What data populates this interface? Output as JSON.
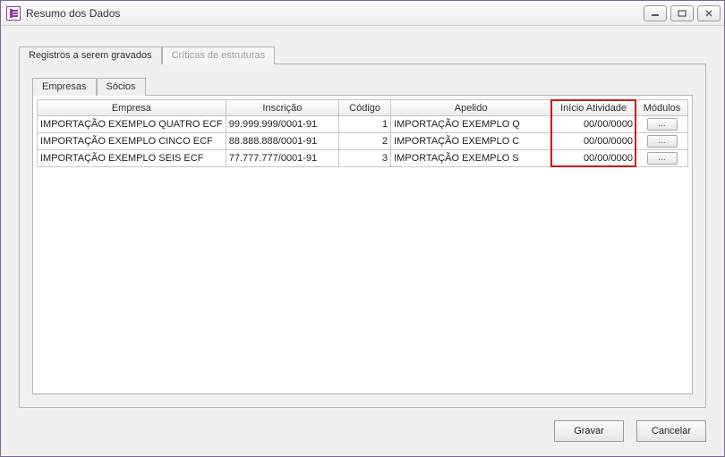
{
  "window": {
    "title": "Resumo dos Dados"
  },
  "outer_tabs": {
    "records": "Registros a serem gravados",
    "critics": "Críticas de estruturas"
  },
  "inner_tabs": {
    "empresas": "Empresas",
    "socios": "Sócios"
  },
  "columns": {
    "empresa": "Empresa",
    "inscricao": "Inscrição",
    "codigo": "Código",
    "apelido": "Apelido",
    "inicio": "Início Atividade",
    "modulos": "Módulos"
  },
  "rows": [
    {
      "empresa": "IMPORTAÇÃO EXEMPLO QUATRO ECF",
      "inscricao": "99.999.999/0001-91",
      "codigo": "1",
      "apelido": "IMPORTAÇÃO EXEMPLO Q",
      "inicio": "00/00/0000",
      "mod": "..."
    },
    {
      "empresa": "IMPORTAÇÃO EXEMPLO CINCO ECF",
      "inscricao": "88.888.888/0001-91",
      "codigo": "2",
      "apelido": "IMPORTAÇÃO EXEMPLO C",
      "inicio": "00/00/0000",
      "mod": "..."
    },
    {
      "empresa": "IMPORTAÇÃO EXEMPLO SEIS ECF",
      "inscricao": "77.777.777/0001-91",
      "codigo": "3",
      "apelido": "IMPORTAÇÃO EXEMPLO S",
      "inicio": "00/00/0000",
      "mod": "..."
    }
  ],
  "buttons": {
    "gravar": "Gravar",
    "cancelar": "Cancelar"
  }
}
